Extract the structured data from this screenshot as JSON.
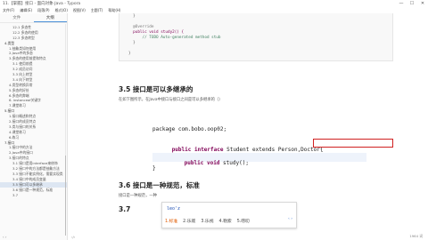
{
  "window": {
    "title": "11.【掌握】接口 - 面向对象-Java - Typora",
    "controls": [
      "—",
      "☐",
      "✕"
    ]
  },
  "menu": [
    "文件(F)",
    "编辑(E)",
    "段落(P)",
    "格式(O)",
    "视图(V)",
    "主题(T)",
    "帮助(H)"
  ],
  "sidebar": {
    "tabs": [
      "文件",
      "大纲"
    ],
    "outline": [
      {
        "label": "12.1 多态性",
        "level": 3
      },
      {
        "label": "12.2 多态的使用",
        "level": 3
      },
      {
        "label": "12.3 多态转型",
        "level": 3
      },
      {
        "label": "4.类型",
        "level": 1
      },
      {
        "label": "1.抽象类如何使用",
        "level": 2
      },
      {
        "label": "2.Java中的多态",
        "level": 2
      },
      {
        "label": "3.多态的使用前提和特点",
        "level": 2
      },
      {
        "label": "3.1 使用前提",
        "level": 3
      },
      {
        "label": "3.2 成员访问",
        "level": 3
      },
      {
        "label": "3.3 向上转型",
        "level": 3
      },
      {
        "label": "3.4 向下转型",
        "level": 3
      },
      {
        "label": "4.类型转换异常",
        "level": 2
      },
      {
        "label": "5.多态的好处",
        "level": 2
      },
      {
        "label": "6.多态的弊端",
        "level": 2
      },
      {
        "label": "6. instanceof关键字",
        "level": 2
      },
      {
        "label": "7.课堂练习",
        "level": 2
      },
      {
        "label": "5.接口",
        "level": 1
      },
      {
        "label": "1.接口概述和特点",
        "level": 2
      },
      {
        "label": "2.接口的成员特点",
        "level": 2
      },
      {
        "label": "3.类与接口的关系",
        "level": 2
      },
      {
        "label": "4.课堂练习",
        "level": 2
      },
      {
        "label": "6.练习",
        "level": 2
      },
      {
        "label": "7.接口",
        "level": 1
      },
      {
        "label": "1.接口中的方法",
        "level": 2
      },
      {
        "label": "2.Java中的接口",
        "level": 2
      },
      {
        "label": "3.接口的特点",
        "level": 2
      },
      {
        "label": "3.1 接口是用interface来修饰",
        "level": 3
      },
      {
        "label": "3.2 接口中的方法都是抽象方法",
        "level": 3
      },
      {
        "label": "3.3 接口不能实例化，需要实现类",
        "level": 3
      },
      {
        "label": "3.4 接口中的成员变量",
        "level": 3
      },
      {
        "label": "3.5 接口可以多继承",
        "level": 3
      },
      {
        "label": "3.6 接口是一种规范，标准",
        "level": 3
      },
      {
        "label": "3.7",
        "level": 3
      }
    ],
    "active_index": 30,
    "footer": "‹ ›"
  },
  "doc": {
    "code_top": [
      "  }",
      "",
      "  @Override",
      "  public void study2() {",
      "      // TODO Auto-generated method stub",
      "  }",
      "",
      "}"
    ],
    "h_35": "3.5 接口是可以多继承的",
    "p_35": "在如下图所示，在Java中接口与接口之间是可以多继承的（）",
    "ide": {
      "line1": "package com.bobo.oop02;",
      "line2_kw": "public interface",
      "line2_rest": " Student ",
      "line2_box": "extends Person,Doctor{",
      "line3_kw": "public void",
      "line3_rest": " study();",
      "line4": "}"
    },
    "h_36": "3.6 接口是一种规范，标准",
    "p_36": "接口是一种规范，一种",
    "h_37": "3.7"
  },
  "ime": {
    "input": "leo'z",
    "candidates": [
      "1.标准",
      "2.乐观",
      "3.乐视",
      "4.勒索",
      "5.唠叨"
    ],
    "arrows": "‹ ›"
  },
  "status": {
    "left": "‹/›",
    "right": "1964 词"
  }
}
